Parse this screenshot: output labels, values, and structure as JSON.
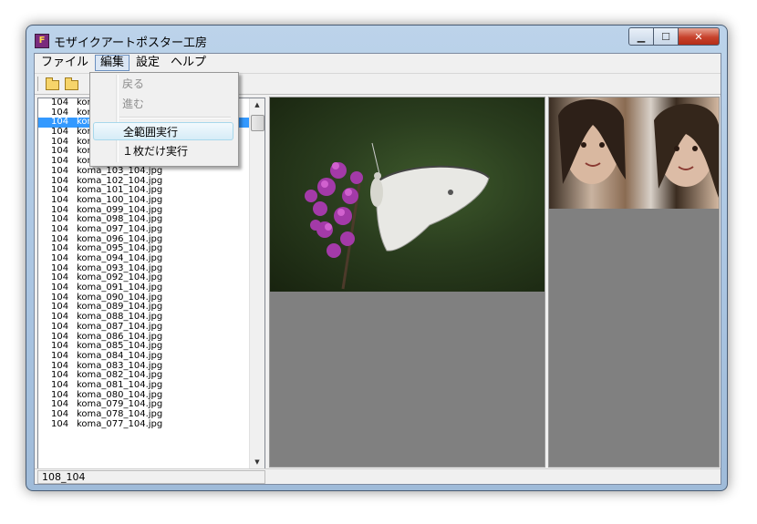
{
  "window": {
    "title": "モザイクアートポスター工房",
    "icon_letter": "F"
  },
  "menubar": {
    "items": [
      "ファイル",
      "編集",
      "設定",
      "ヘルプ"
    ],
    "active_index": 1
  },
  "dropdown": {
    "items": [
      {
        "label": "戻る",
        "enabled": false
      },
      {
        "label": "進む",
        "enabled": false
      },
      {
        "label": "全範囲実行",
        "enabled": true,
        "highlighted": true
      },
      {
        "label": "１枚だけ実行",
        "enabled": true
      }
    ]
  },
  "list": {
    "rows": [
      {
        "num": "104",
        "name": "kor"
      },
      {
        "num": "104",
        "name": "kor"
      },
      {
        "num": "104",
        "name": "kor"
      },
      {
        "num": "104",
        "name": "kor"
      },
      {
        "num": "104",
        "name": "kor"
      },
      {
        "num": "104",
        "name": "kor"
      },
      {
        "num": "104",
        "name": "koma_104_104.jpg"
      },
      {
        "num": "104",
        "name": "koma_103_104.jpg"
      },
      {
        "num": "104",
        "name": "koma_102_104.jpg"
      },
      {
        "num": "104",
        "name": "koma_101_104.jpg"
      },
      {
        "num": "104",
        "name": "koma_100_104.jpg"
      },
      {
        "num": "104",
        "name": "koma_099_104.jpg"
      },
      {
        "num": "104",
        "name": "koma_098_104.jpg"
      },
      {
        "num": "104",
        "name": "koma_097_104.jpg"
      },
      {
        "num": "104",
        "name": "koma_096_104.jpg"
      },
      {
        "num": "104",
        "name": "koma_095_104.jpg"
      },
      {
        "num": "104",
        "name": "koma_094_104.jpg"
      },
      {
        "num": "104",
        "name": "koma_093_104.jpg"
      },
      {
        "num": "104",
        "name": "koma_092_104.jpg"
      },
      {
        "num": "104",
        "name": "koma_091_104.jpg"
      },
      {
        "num": "104",
        "name": "koma_090_104.jpg"
      },
      {
        "num": "104",
        "name": "koma_089_104.jpg"
      },
      {
        "num": "104",
        "name": "koma_088_104.jpg"
      },
      {
        "num": "104",
        "name": "koma_087_104.jpg"
      },
      {
        "num": "104",
        "name": "koma_086_104.jpg"
      },
      {
        "num": "104",
        "name": "koma_085_104.jpg"
      },
      {
        "num": "104",
        "name": "koma_084_104.jpg"
      },
      {
        "num": "104",
        "name": "koma_083_104.jpg"
      },
      {
        "num": "104",
        "name": "koma_082_104.jpg"
      },
      {
        "num": "104",
        "name": "koma_081_104.jpg"
      },
      {
        "num": "104",
        "name": "koma_080_104.jpg"
      },
      {
        "num": "104",
        "name": "koma_079_104.jpg"
      },
      {
        "num": "104",
        "name": "koma_078_104.jpg"
      },
      {
        "num": "104",
        "name": "koma_077_104.jpg"
      }
    ],
    "selected_index": 2
  },
  "statusbar": {
    "text": "108_104"
  },
  "colors": {
    "selection": "#3399ff",
    "panel_bg": "#808080",
    "close_button": "#c7422c"
  }
}
